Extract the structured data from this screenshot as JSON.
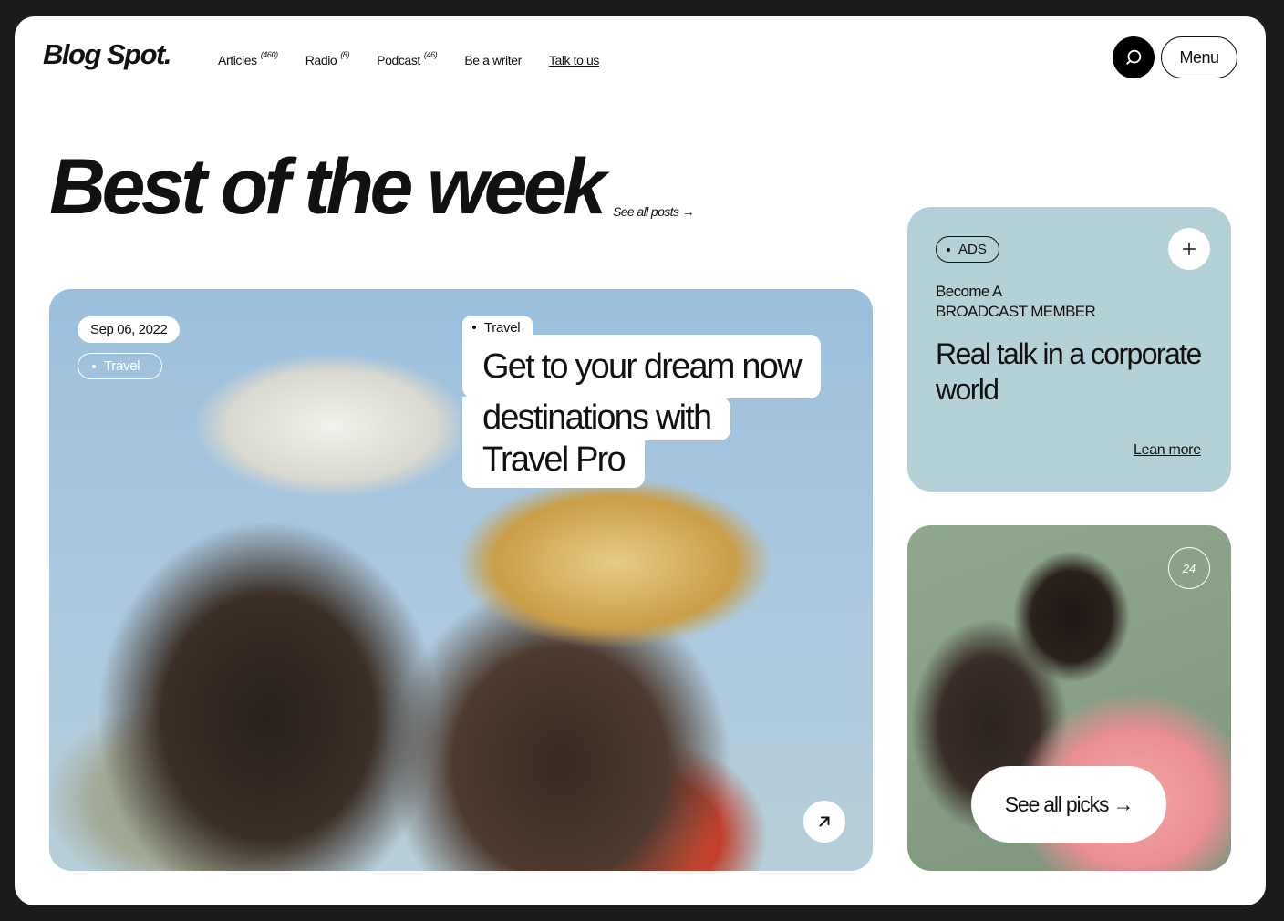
{
  "header": {
    "logo": "Blog Spot.",
    "nav": [
      {
        "label": "Articles",
        "count": "(460)"
      },
      {
        "label": "Radio",
        "count": "(8)"
      },
      {
        "label": "Podcast",
        "count": "(46)"
      },
      {
        "label": "Be a writer",
        "count": ""
      },
      {
        "label": "Talk to us",
        "count": ""
      }
    ],
    "search_icon": "search-icon",
    "menu_label": "Menu"
  },
  "hero": {
    "title": "Best of the week",
    "see_all_label": "See all posts"
  },
  "feature": {
    "date": "Sep 06, 2022",
    "category_pill": "Travel",
    "tag": "Travel",
    "title_lines": [
      "Get to your dream now",
      "destinations with",
      "Travel Pro"
    ],
    "arrow_icon": "arrow-up-right-icon"
  },
  "ad": {
    "badge": "ADS",
    "subtitle_lines": [
      "Become A",
      "BROADCAST MEMBER"
    ],
    "title": "Real talk in a corporate world",
    "link": "Lean more",
    "bg_color": "#b4d1d7"
  },
  "picks": {
    "count": "24",
    "button_label": "See all picks"
  }
}
